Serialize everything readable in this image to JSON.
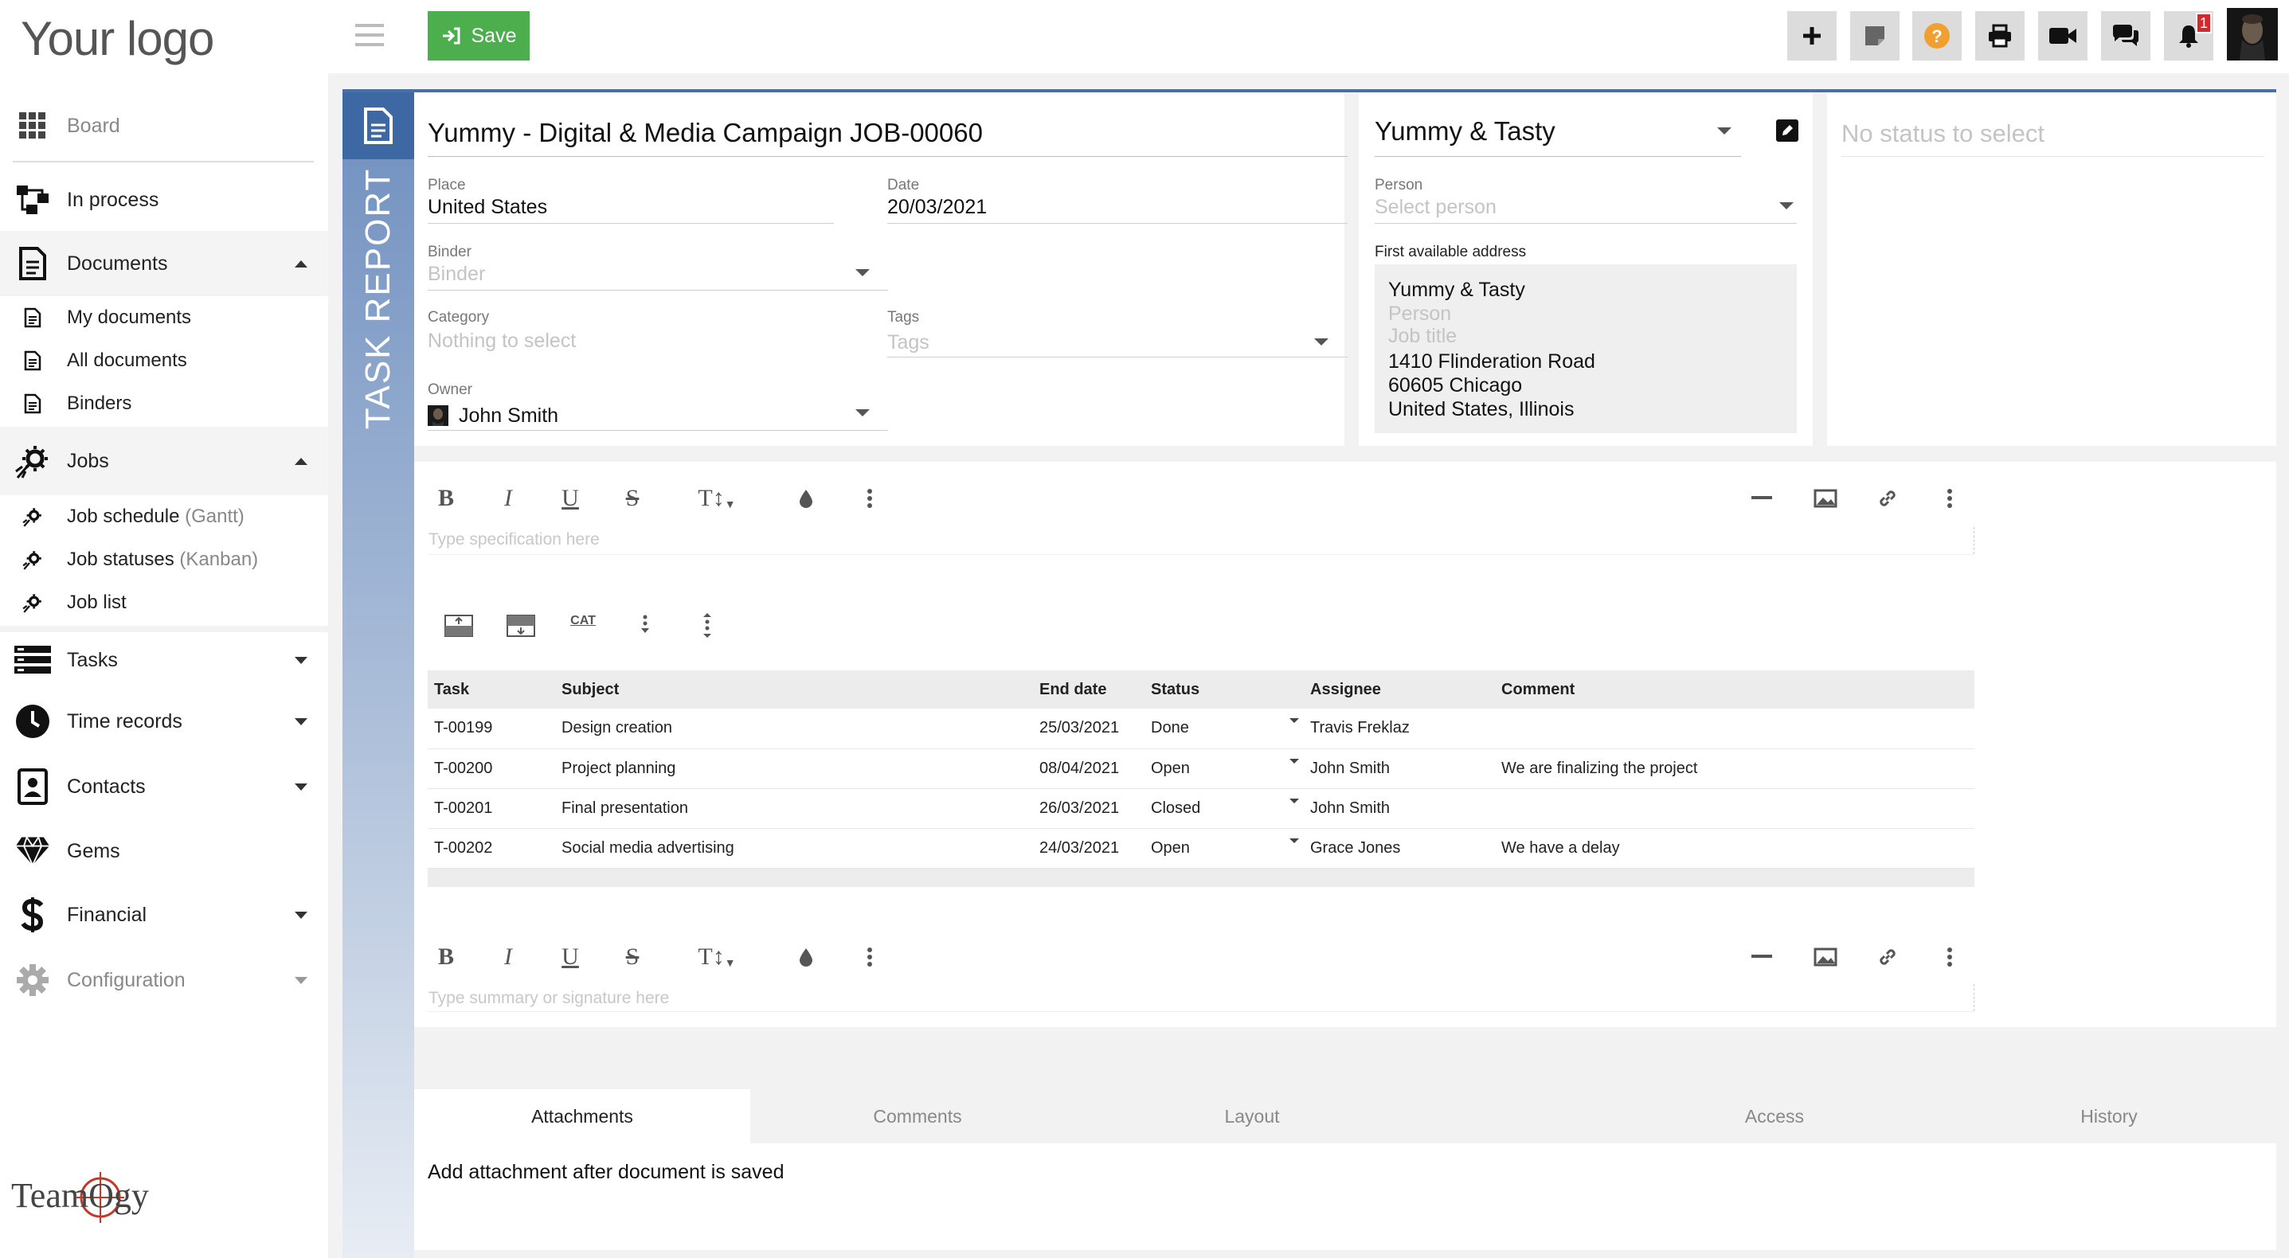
{
  "brand": {
    "logo_text": "Your logo",
    "footer_logo": "TeamOgy"
  },
  "sidebar": {
    "board": "Board",
    "in_process": "In process",
    "documents": "Documents",
    "my_documents": "My documents",
    "all_documents": "All documents",
    "binders": "Binders",
    "jobs": "Jobs",
    "job_schedule": "Job schedule",
    "job_schedule_hint": "(Gantt)",
    "job_statuses": "Job statuses",
    "job_statuses_hint": "(Kanban)",
    "job_list": "Job list",
    "tasks": "Tasks",
    "time_records": "Time records",
    "contacts": "Contacts",
    "gems": "Gems",
    "financial": "Financial",
    "configuration": "Configuration"
  },
  "toolbar": {
    "save_label": "Save",
    "notification_count": "1"
  },
  "document": {
    "vertical_title": "TASK REPORT",
    "title": "Yummy - Digital & Media Campaign JOB-00060",
    "place_label": "Place",
    "place_value": "United States",
    "date_label": "Date",
    "date_value": "20/03/2021",
    "binder_label": "Binder",
    "binder_placeholder": "Binder",
    "category_label": "Category",
    "category_placeholder": "Nothing to select",
    "tags_label": "Tags",
    "tags_placeholder": "Tags",
    "owner_label": "Owner",
    "owner_value": "John Smith"
  },
  "customer": {
    "company": "Yummy & Tasty",
    "person_label": "Person",
    "person_placeholder": "Select person",
    "address_label": "First available address",
    "address_company": "Yummy & Tasty",
    "address_person": "Person",
    "address_job_title": "Job title",
    "address_street": "1410 Flinderation Road",
    "address_city": "60605 Chicago",
    "address_country": "United States, Illinois"
  },
  "status": {
    "placeholder": "No status to select"
  },
  "editor": {
    "specification_placeholder": "Type specification here",
    "summary_placeholder": "Type summary or signature here",
    "cat_label": "CAT"
  },
  "tasks_table": {
    "headers": [
      "Task",
      "Subject",
      "End date",
      "Status",
      "Assignee",
      "Comment"
    ],
    "rows": [
      [
        "T-00199",
        "Design creation",
        "25/03/2021",
        "Done",
        "Travis Freklaz",
        ""
      ],
      [
        "T-00200",
        "Project planning",
        "08/04/2021",
        "Open",
        "John Smith",
        "We are finalizing the project"
      ],
      [
        "T-00201",
        "Final presentation",
        "26/03/2021",
        "Closed",
        "John Smith",
        ""
      ],
      [
        "T-00202",
        "Social media advertising",
        "24/03/2021",
        "Open",
        "Grace Jones",
        "We have a delay"
      ]
    ]
  },
  "tabs": [
    "Attachments",
    "Comments",
    "Layout",
    "Access",
    "History"
  ],
  "attachments": {
    "message": "Add attachment after document is saved"
  },
  "colors": {
    "accent_blue": "#3e68a3",
    "save_green": "#4cae4c",
    "help_orange": "#f0a030",
    "badge_red": "#d9262b"
  }
}
